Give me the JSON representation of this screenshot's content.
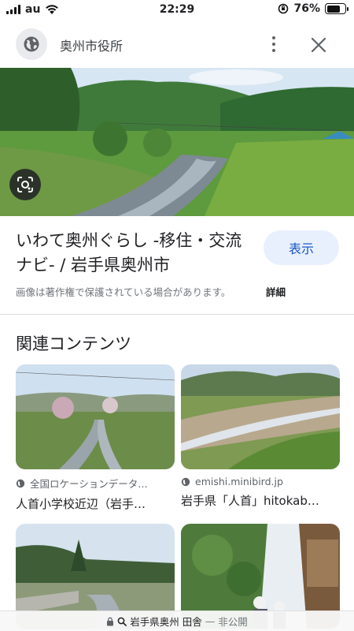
{
  "status_bar": {
    "carrier": "au",
    "time": "22:29",
    "battery": "76%",
    "battery_level": 0.76
  },
  "header": {
    "site_name": "奥州市役所",
    "icons": {
      "site": "globe-icon",
      "more": "more-vert-icon",
      "close": "close-icon"
    }
  },
  "result": {
    "title": "いわて奥州ぐらし -移住・交流ナビ- / 岩手県奥州市",
    "visit_label": "表示",
    "copyright_notice": "画像は著作権で保護されている場合があります。",
    "details_label": "詳細"
  },
  "related": {
    "heading": "関連コンテンツ",
    "items": [
      {
        "source": "全国ロケーションデータ…",
        "title": "人首小学校近辺（岩手…"
      },
      {
        "source": "emishi.minibird.jp",
        "title": "岩手県「人首」hitokab…"
      },
      {
        "source": "",
        "title": ""
      },
      {
        "source": "",
        "title": ""
      }
    ]
  },
  "url_bar": {
    "query": "岩手県奥州 田舎",
    "separator": "—",
    "mode": "非公開"
  },
  "colors": {
    "visit_bg": "#e8f0fe",
    "visit_text": "#1a57c6",
    "divider": "#dadce0"
  }
}
